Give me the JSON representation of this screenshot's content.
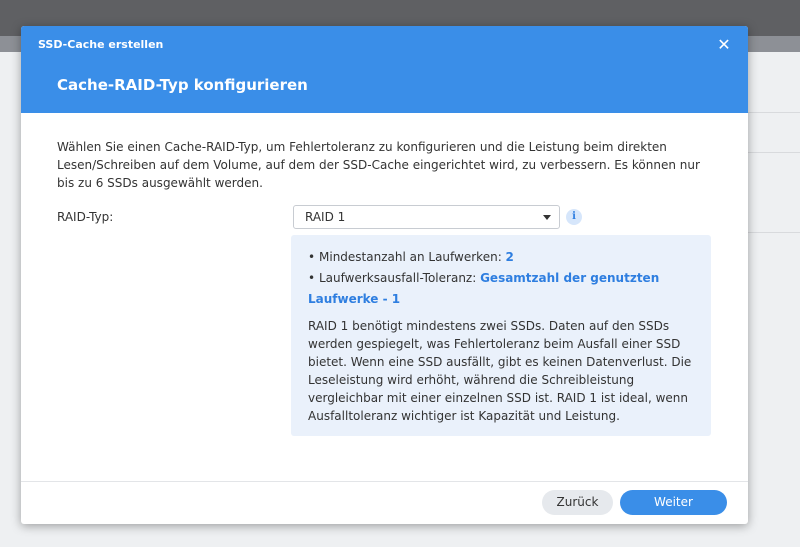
{
  "dialog": {
    "window_title": "SSD-Cache erstellen",
    "close_glyph": "✕",
    "step_title": "Cache-RAID-Typ konfigurieren",
    "description": "Wählen Sie einen Cache-RAID-Typ, um Fehlertoleranz zu konfigurieren und die Leistung beim direkten Lesen/Schreiben auf dem Volume, auf dem der SSD-Cache eingerichtet wird, zu verbessern. Es können nur bis zu 6 SSDs ausgewählt werden."
  },
  "raid": {
    "label": "RAID-Typ:",
    "selected": "RAID 1",
    "info_glyph": "i"
  },
  "info": {
    "bullets": [
      {
        "label": "Mindestanzahl an Laufwerken: ",
        "value": "2"
      },
      {
        "label": "Laufwerksausfall-Toleranz: ",
        "value": "Gesamtzahl der genutzten Laufwerke - 1"
      }
    ],
    "paragraph": "RAID 1 benötigt mindestens zwei SSDs. Daten auf den SSDs werden gespiegelt, was Fehlertoleranz beim Ausfall einer SSD bietet. Wenn eine SSD ausfällt, gibt es keinen Datenverlust. Die Leseleistung wird erhöht, während die Schreibleistung vergleichbar mit einer einzelnen SSD ist. RAID 1 ist ideal, wenn Ausfalltoleranz wichtiger ist Kapazität und Leistung."
  },
  "footer": {
    "back_label": "Zurück",
    "next_label": "Weiter"
  },
  "colors": {
    "accent": "#3a8ee8",
    "info_background": "#eaf1fb",
    "link_value": "#2e7ee0"
  }
}
